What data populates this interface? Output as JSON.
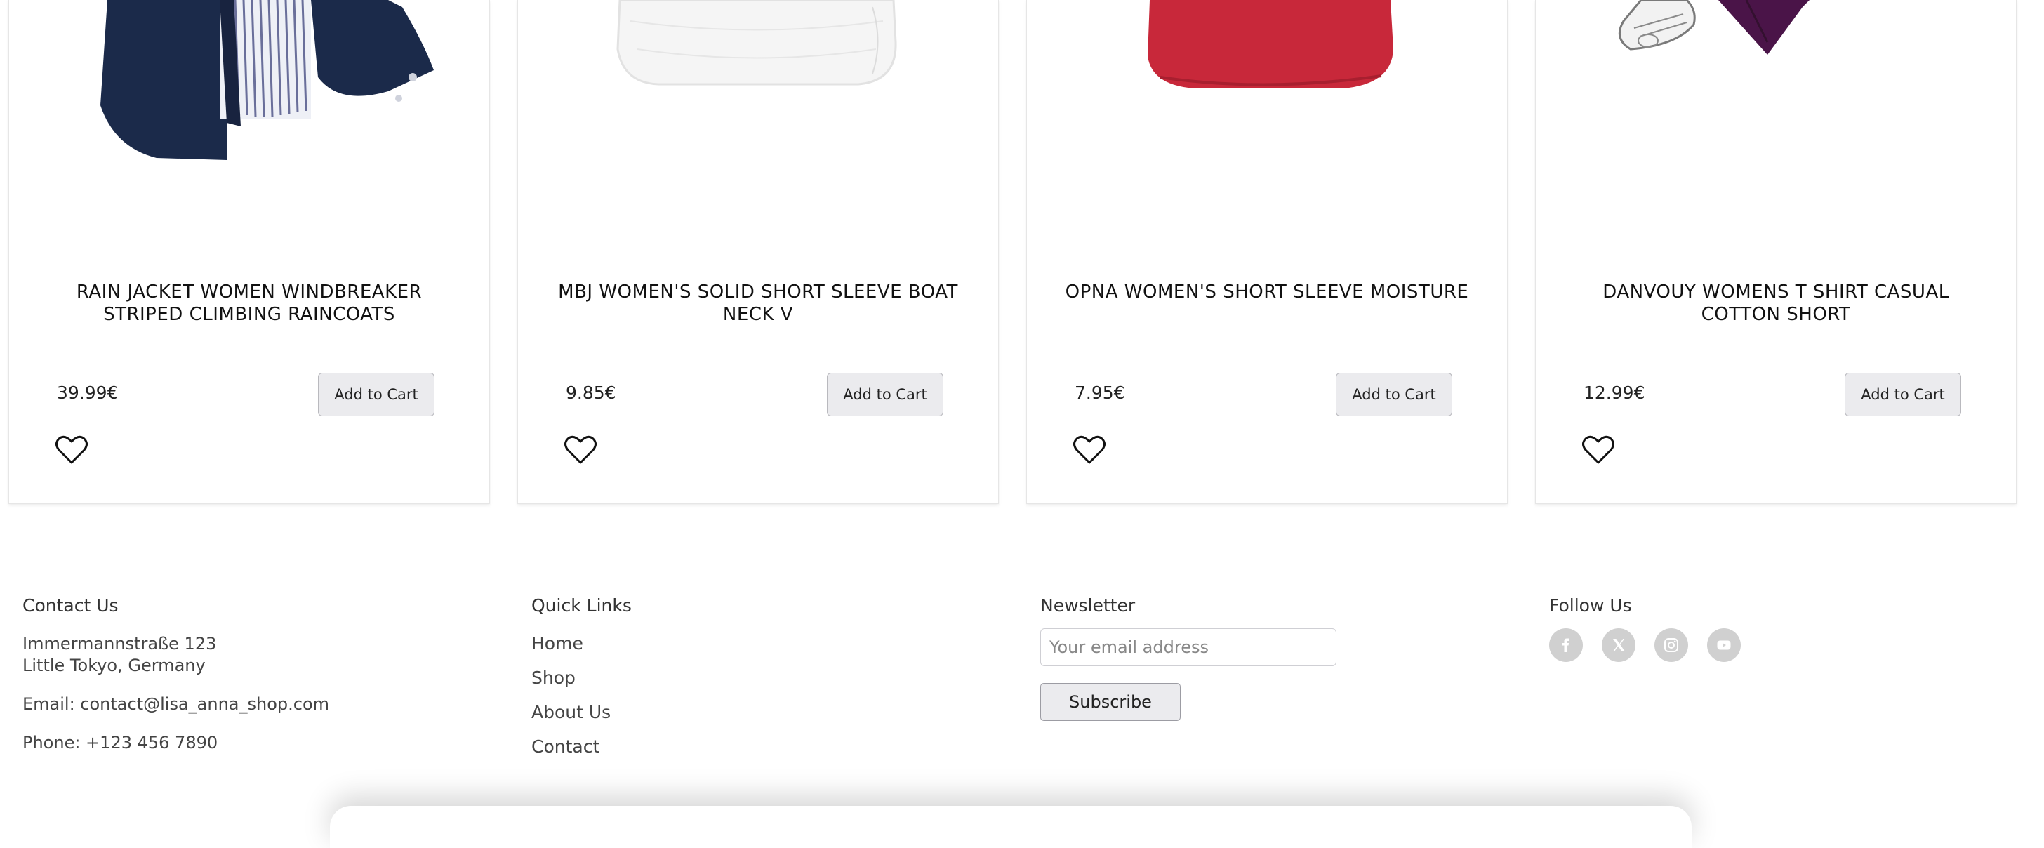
{
  "products": [
    {
      "title": "RAIN JACKET WOMEN WINDBREAKER STRIPED CLIMBING RAINCOATS",
      "price": "39.99€",
      "add_to_cart": "Add to Cart"
    },
    {
      "title": "MBJ WOMEN'S SOLID SHORT SLEEVE BOAT NECK V",
      "price": "9.85€",
      "add_to_cart": "Add to Cart"
    },
    {
      "title": "OPNA WOMEN'S SHORT SLEEVE MOISTURE",
      "price": "7.95€",
      "add_to_cart": "Add to Cart"
    },
    {
      "title": "DANVOUY WOMENS T SHIRT CASUAL COTTON SHORT",
      "price": "12.99€",
      "add_to_cart": "Add to Cart"
    }
  ],
  "footer": {
    "contact": {
      "title": "Contact Us",
      "address_line1": "Immermannstraße 123",
      "address_line2": "Little Tokyo, Germany",
      "email": "Email: contact@lisa_anna_shop.com",
      "phone": "Phone: +123 456 7890"
    },
    "quick_links": {
      "title": "Quick Links",
      "links": [
        "Home",
        "Shop",
        "About Us",
        "Contact"
      ]
    },
    "newsletter": {
      "title": "Newsletter",
      "placeholder": "Your email address",
      "button": "Subscribe"
    },
    "follow": {
      "title": "Follow Us",
      "icons": [
        "facebook-icon",
        "x-icon",
        "instagram-icon",
        "youtube-icon"
      ]
    }
  },
  "colors": {
    "button_bg": "#ebebee",
    "social_icon_bg": "#d0d0d0",
    "jacket": "#1b2a4a",
    "red_shirt": "#c8283a",
    "purple_shirt": "#4a1448"
  }
}
